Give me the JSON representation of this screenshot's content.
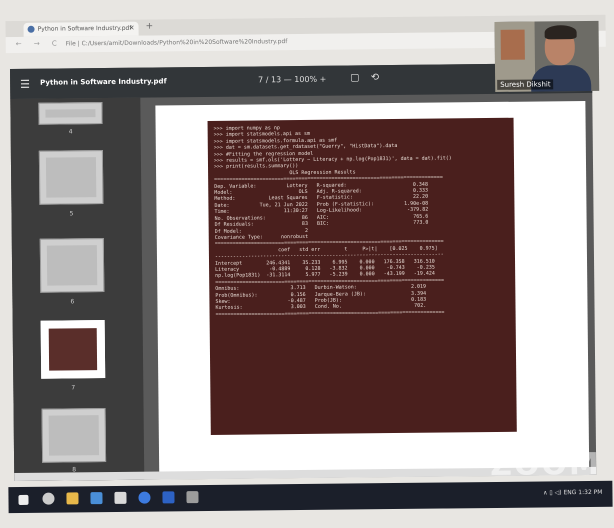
{
  "browser": {
    "tab_title": "Python in Software Industry.pdf",
    "close_glyph": "×",
    "new_tab_glyph": "+",
    "nav_glyphs": "← → C",
    "url": "File | C:/Users/amit/Downloads/Python%20in%20Software%20Industry.pdf"
  },
  "viewer": {
    "menu_glyph": "☰",
    "doc_title": "Python in Software Industry.pdf",
    "pager": "7 / 13   —   100%  +",
    "toolbar_icons": "▢ ⟲",
    "thumbnails": [
      {
        "num": "4"
      },
      {
        "num": "5"
      },
      {
        "num": "6"
      },
      {
        "num": "7"
      },
      {
        "num": "8"
      }
    ]
  },
  "terminal_lines": [
    ">>> import numpy as np",
    ">>> import statsmodels.api as sm",
    ">>> import statsmodels.formula.api as smf",
    ">>> dat = sm.datasets.get_rdataset(\"Guerry\", \"HistData\").data",
    ">>> #Fitting the regression model",
    ">>> results = smf.ols('Lottery ~ Literacy + np.log(Pop1831)', data = dat).fit()",
    ">>> print(results.summary())",
    "                         OLS Regression Results",
    "============================================================================",
    "Dep. Variable:          Lottery   R-squared:                      0.348",
    "Model:                      OLS   Adj. R-squared:                 0.333",
    "Method:           Least Squares   F-statistic:                    22.20",
    "Date:          Tue, 21 Jun 2022   Prob (F-statistic):          1.90e-08",
    "Time:                  11:30:27   Log-Likelihood:               -379.82",
    "No. Observations:            86   AIC:                            765.6",
    "Df Residuals:                83   BIC:                            773.0",
    "Df Model:                     2",
    "Covariance Type:      nonrobust",
    "============================================================================",
    "                     coef   std err        t     P>|t|    [0.025    0.975]",
    "----------------------------------------------------------------------------",
    "Intercept        246.4341    35.233    6.995    0.000   176.358   316.510",
    "Literacy          -0.4889     0.128   -3.832    0.000    -0.743    -0.235",
    "np.log(Pop1831)  -31.3114     5.977   -5.239    0.000   -43.199   -19.424",
    "============================================================================",
    "Omnibus:                 3.713   Durbin-Watson:                  2.019",
    "Prob(Omnibus):           0.156   Jarque-Bera (JB):               3.394",
    "Skew:                   -0.487   Prob(JB):                       0.183",
    "Kurtosis:                3.003   Cond. No.                        702.",
    "============================================================================"
  ],
  "webcam": {
    "name": "Suresh Dikshit"
  },
  "watermark": "ZOOM",
  "taskbar": {
    "tray": "∧ ▯ ◁) ENG  1:32 PM"
  }
}
